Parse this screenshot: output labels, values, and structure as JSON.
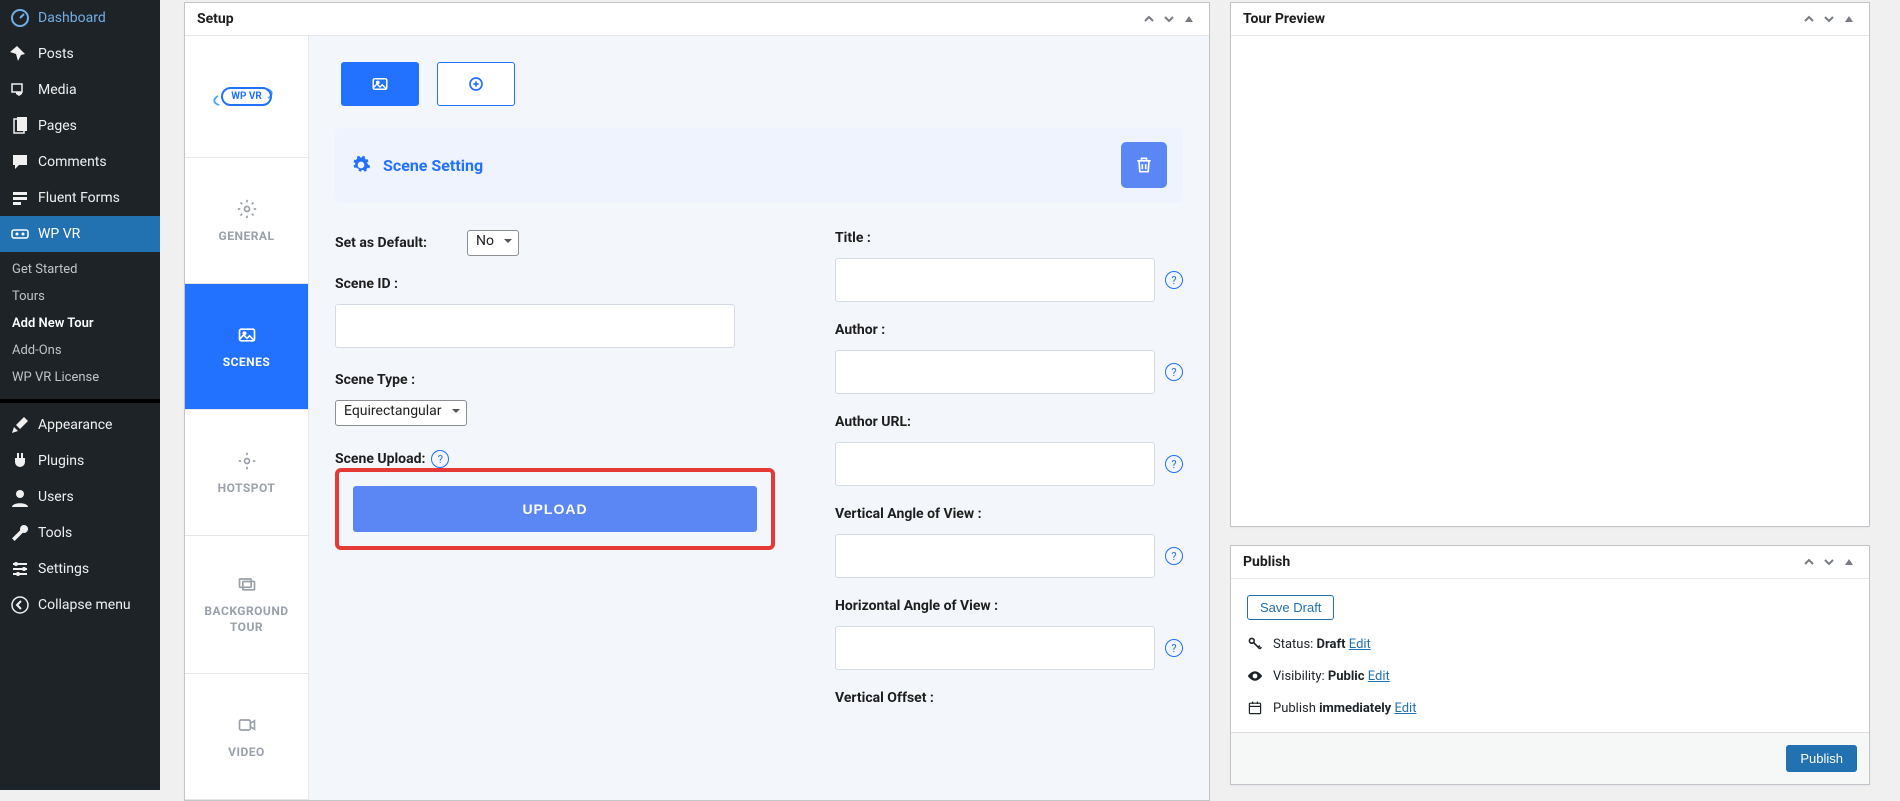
{
  "sidebar": {
    "items": [
      {
        "label": "Dashboard",
        "icon": "dashboard"
      },
      {
        "label": "Posts",
        "icon": "pin"
      },
      {
        "label": "Media",
        "icon": "media"
      },
      {
        "label": "Pages",
        "icon": "pages"
      },
      {
        "label": "Comments",
        "icon": "comment"
      },
      {
        "label": "Fluent Forms",
        "icon": "form"
      },
      {
        "label": "WP VR",
        "icon": "vr"
      },
      {
        "label": "Appearance",
        "icon": "brush"
      },
      {
        "label": "Plugins",
        "icon": "plug"
      },
      {
        "label": "Users",
        "icon": "user"
      },
      {
        "label": "Tools",
        "icon": "wrench"
      },
      {
        "label": "Settings",
        "icon": "sliders"
      },
      {
        "label": "Collapse menu",
        "icon": "collapse"
      }
    ],
    "submenu": [
      {
        "label": "Get Started"
      },
      {
        "label": "Tours"
      },
      {
        "label": "Add New Tour"
      },
      {
        "label": "Add-Ons"
      },
      {
        "label": "WP VR License"
      }
    ]
  },
  "setup": {
    "title": "Setup",
    "logo_text": "WP VR",
    "vtabs": {
      "general": "GENERAL",
      "scenes": "SCENES",
      "hotspot": "HOTSPOT",
      "bgtour_l1": "BACKGROUND",
      "bgtour_l2": "TOUR",
      "video": "VIDEO"
    },
    "scene_heading": "Scene Setting",
    "fields": {
      "set_default_label": "Set as Default:",
      "set_default_value": "No",
      "scene_id_label": "Scene ID :",
      "scene_type_label": "Scene Type :",
      "scene_type_value": "Equirectangular",
      "scene_upload_label": "Scene Upload:",
      "upload_btn": "UPLOAD",
      "title_label": "Title :",
      "author_label": "Author :",
      "author_url_label": "Author URL:",
      "vaov_label": "Vertical Angle of View :",
      "haov_label": "Horizontal Angle of View :",
      "voffset_label": "Vertical Offset :"
    }
  },
  "preview": {
    "title": "Tour Preview"
  },
  "publish": {
    "title": "Publish",
    "save_draft": "Save Draft",
    "status_label": "Status: ",
    "status_value": "Draft",
    "visibility_label": "Visibility: ",
    "visibility_value": "Public",
    "publish_label": "Publish ",
    "publish_value": "immediately",
    "edit": "Edit",
    "publish_btn": "Publish"
  }
}
